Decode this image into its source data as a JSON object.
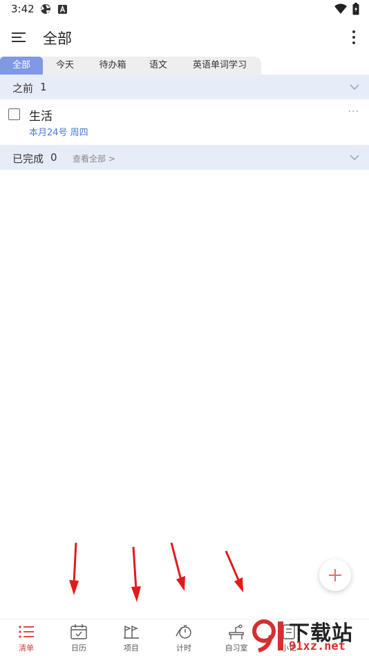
{
  "status_bar": {
    "time": "3:42"
  },
  "app_bar": {
    "title": "全部"
  },
  "tabs": [
    {
      "label": "全部",
      "active": true
    },
    {
      "label": "今天",
      "active": false
    },
    {
      "label": "待办箱",
      "active": false
    },
    {
      "label": "语文",
      "active": false
    },
    {
      "label": "英语单词学习",
      "active": false
    }
  ],
  "sections": {
    "before": {
      "title": "之前",
      "count": "1"
    },
    "completed": {
      "title": "已完成",
      "count": "0",
      "view_all": "查看全部 >"
    }
  },
  "tasks": [
    {
      "title": "生活",
      "date": "本月24号 周四",
      "checked": false,
      "more": "···"
    }
  ],
  "bottom_nav": [
    {
      "label": "清单",
      "icon": "list-icon",
      "active": true
    },
    {
      "label": "日历",
      "icon": "calendar-icon",
      "active": false
    },
    {
      "label": "项目",
      "icon": "project-icon",
      "active": false
    },
    {
      "label": "计时",
      "icon": "timer-icon",
      "active": false
    },
    {
      "label": "自习室",
      "icon": "study-room-icon",
      "active": false
    },
    {
      "label": "小记",
      "icon": "notes-icon",
      "active": false
    }
  ],
  "watermark": {
    "top": "下载站",
    "bottom": "91xz.net",
    "logo_text": "91"
  },
  "colors": {
    "accent": "#7f9ae3",
    "section_bg": "#e7ecf9",
    "date_blue": "#4a78d6",
    "active_red": "#d23b3b",
    "annotation_red": "#e01b1b"
  }
}
